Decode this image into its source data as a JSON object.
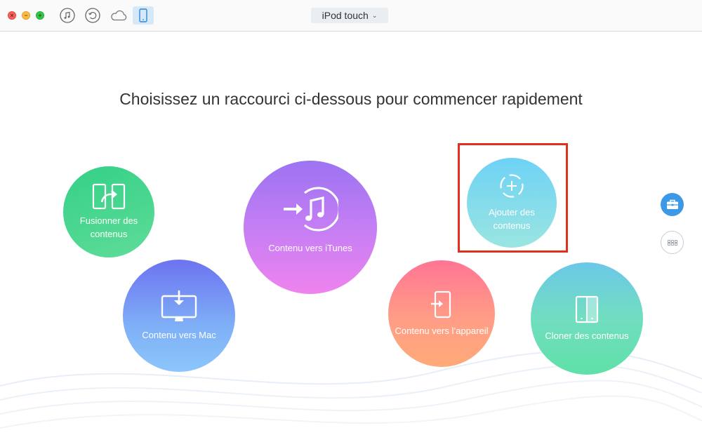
{
  "window": {
    "device_selector": "iPod touch",
    "toolbar_icons": [
      "music-note-icon",
      "restore-icon",
      "cloud-icon",
      "device-icon"
    ]
  },
  "main": {
    "headline": "Choisissez un raccourci ci-dessous pour commencer rapidement",
    "shortcuts": {
      "merge": {
        "line1": "Fusionner des",
        "line2": "contenus"
      },
      "to_mac": {
        "label": "Contenu vers Mac"
      },
      "to_itunes": {
        "label": "Contenu vers iTunes"
      },
      "add": {
        "line1": "Ajouter des",
        "line2": "contenus"
      },
      "to_device": {
        "label": "Contenu vers l’appareil"
      },
      "clone": {
        "label": "Cloner des contenus"
      }
    }
  },
  "sidebar": {
    "items": [
      "toolbox-icon",
      "grid-icon"
    ]
  },
  "colors": {
    "highlight": "#e0301e",
    "accent": "#3d98e6"
  }
}
